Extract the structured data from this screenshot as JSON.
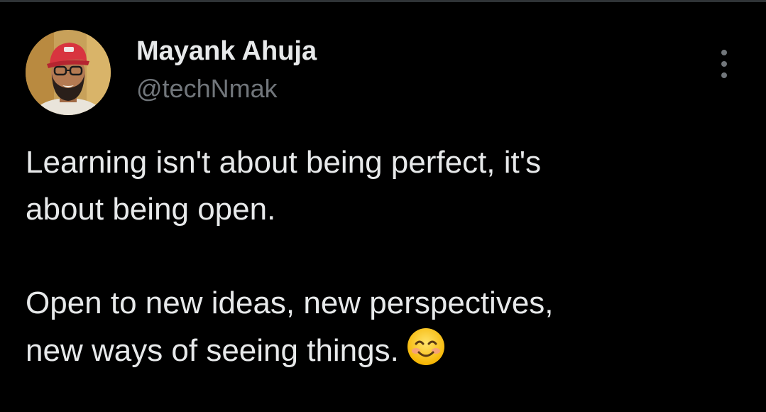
{
  "tweet": {
    "author_name": "Mayank Ahuja",
    "author_handle": "@techNmak",
    "paragraphs": [
      "Learning isn't about being perfect, it's",
      "about being open.",
      "Open to new ideas, new perspectives,",
      "new ways of seeing things."
    ],
    "emoji": "smiling-face-with-smiling-eyes",
    "more_icon": "more-vertical-icon"
  },
  "colors": {
    "background": "#000000",
    "text": "#e7e9ea",
    "muted": "#71767b",
    "avatar_bg": "#c8a15a",
    "cap": "#d8343f"
  }
}
